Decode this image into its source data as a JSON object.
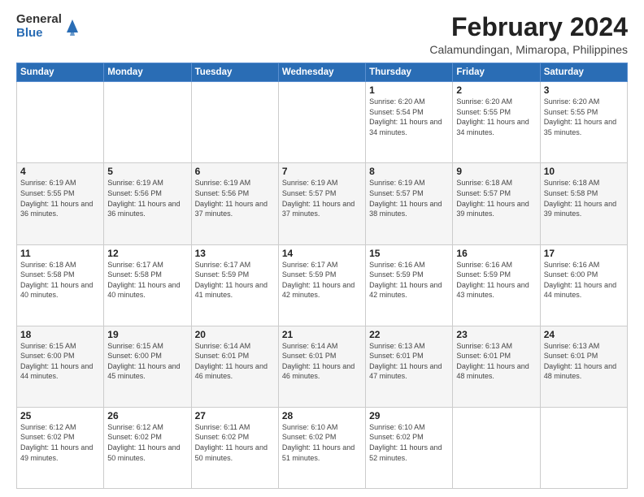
{
  "logo": {
    "general": "General",
    "blue": "Blue"
  },
  "header": {
    "month": "February 2024",
    "location": "Calamundingan, Mimaropa, Philippines"
  },
  "weekdays": [
    "Sunday",
    "Monday",
    "Tuesday",
    "Wednesday",
    "Thursday",
    "Friday",
    "Saturday"
  ],
  "weeks": [
    [
      {
        "day": "",
        "info": ""
      },
      {
        "day": "",
        "info": ""
      },
      {
        "day": "",
        "info": ""
      },
      {
        "day": "",
        "info": ""
      },
      {
        "day": "1",
        "info": "Sunrise: 6:20 AM\nSunset: 5:54 PM\nDaylight: 11 hours and 34 minutes."
      },
      {
        "day": "2",
        "info": "Sunrise: 6:20 AM\nSunset: 5:55 PM\nDaylight: 11 hours and 34 minutes."
      },
      {
        "day": "3",
        "info": "Sunrise: 6:20 AM\nSunset: 5:55 PM\nDaylight: 11 hours and 35 minutes."
      }
    ],
    [
      {
        "day": "4",
        "info": "Sunrise: 6:19 AM\nSunset: 5:55 PM\nDaylight: 11 hours and 36 minutes."
      },
      {
        "day": "5",
        "info": "Sunrise: 6:19 AM\nSunset: 5:56 PM\nDaylight: 11 hours and 36 minutes."
      },
      {
        "day": "6",
        "info": "Sunrise: 6:19 AM\nSunset: 5:56 PM\nDaylight: 11 hours and 37 minutes."
      },
      {
        "day": "7",
        "info": "Sunrise: 6:19 AM\nSunset: 5:57 PM\nDaylight: 11 hours and 37 minutes."
      },
      {
        "day": "8",
        "info": "Sunrise: 6:19 AM\nSunset: 5:57 PM\nDaylight: 11 hours and 38 minutes."
      },
      {
        "day": "9",
        "info": "Sunrise: 6:18 AM\nSunset: 5:57 PM\nDaylight: 11 hours and 39 minutes."
      },
      {
        "day": "10",
        "info": "Sunrise: 6:18 AM\nSunset: 5:58 PM\nDaylight: 11 hours and 39 minutes."
      }
    ],
    [
      {
        "day": "11",
        "info": "Sunrise: 6:18 AM\nSunset: 5:58 PM\nDaylight: 11 hours and 40 minutes."
      },
      {
        "day": "12",
        "info": "Sunrise: 6:17 AM\nSunset: 5:58 PM\nDaylight: 11 hours and 40 minutes."
      },
      {
        "day": "13",
        "info": "Sunrise: 6:17 AM\nSunset: 5:59 PM\nDaylight: 11 hours and 41 minutes."
      },
      {
        "day": "14",
        "info": "Sunrise: 6:17 AM\nSunset: 5:59 PM\nDaylight: 11 hours and 42 minutes."
      },
      {
        "day": "15",
        "info": "Sunrise: 6:16 AM\nSunset: 5:59 PM\nDaylight: 11 hours and 42 minutes."
      },
      {
        "day": "16",
        "info": "Sunrise: 6:16 AM\nSunset: 5:59 PM\nDaylight: 11 hours and 43 minutes."
      },
      {
        "day": "17",
        "info": "Sunrise: 6:16 AM\nSunset: 6:00 PM\nDaylight: 11 hours and 44 minutes."
      }
    ],
    [
      {
        "day": "18",
        "info": "Sunrise: 6:15 AM\nSunset: 6:00 PM\nDaylight: 11 hours and 44 minutes."
      },
      {
        "day": "19",
        "info": "Sunrise: 6:15 AM\nSunset: 6:00 PM\nDaylight: 11 hours and 45 minutes."
      },
      {
        "day": "20",
        "info": "Sunrise: 6:14 AM\nSunset: 6:01 PM\nDaylight: 11 hours and 46 minutes."
      },
      {
        "day": "21",
        "info": "Sunrise: 6:14 AM\nSunset: 6:01 PM\nDaylight: 11 hours and 46 minutes."
      },
      {
        "day": "22",
        "info": "Sunrise: 6:13 AM\nSunset: 6:01 PM\nDaylight: 11 hours and 47 minutes."
      },
      {
        "day": "23",
        "info": "Sunrise: 6:13 AM\nSunset: 6:01 PM\nDaylight: 11 hours and 48 minutes."
      },
      {
        "day": "24",
        "info": "Sunrise: 6:13 AM\nSunset: 6:01 PM\nDaylight: 11 hours and 48 minutes."
      }
    ],
    [
      {
        "day": "25",
        "info": "Sunrise: 6:12 AM\nSunset: 6:02 PM\nDaylight: 11 hours and 49 minutes."
      },
      {
        "day": "26",
        "info": "Sunrise: 6:12 AM\nSunset: 6:02 PM\nDaylight: 11 hours and 50 minutes."
      },
      {
        "day": "27",
        "info": "Sunrise: 6:11 AM\nSunset: 6:02 PM\nDaylight: 11 hours and 50 minutes."
      },
      {
        "day": "28",
        "info": "Sunrise: 6:10 AM\nSunset: 6:02 PM\nDaylight: 11 hours and 51 minutes."
      },
      {
        "day": "29",
        "info": "Sunrise: 6:10 AM\nSunset: 6:02 PM\nDaylight: 11 hours and 52 minutes."
      },
      {
        "day": "",
        "info": ""
      },
      {
        "day": "",
        "info": ""
      }
    ]
  ]
}
